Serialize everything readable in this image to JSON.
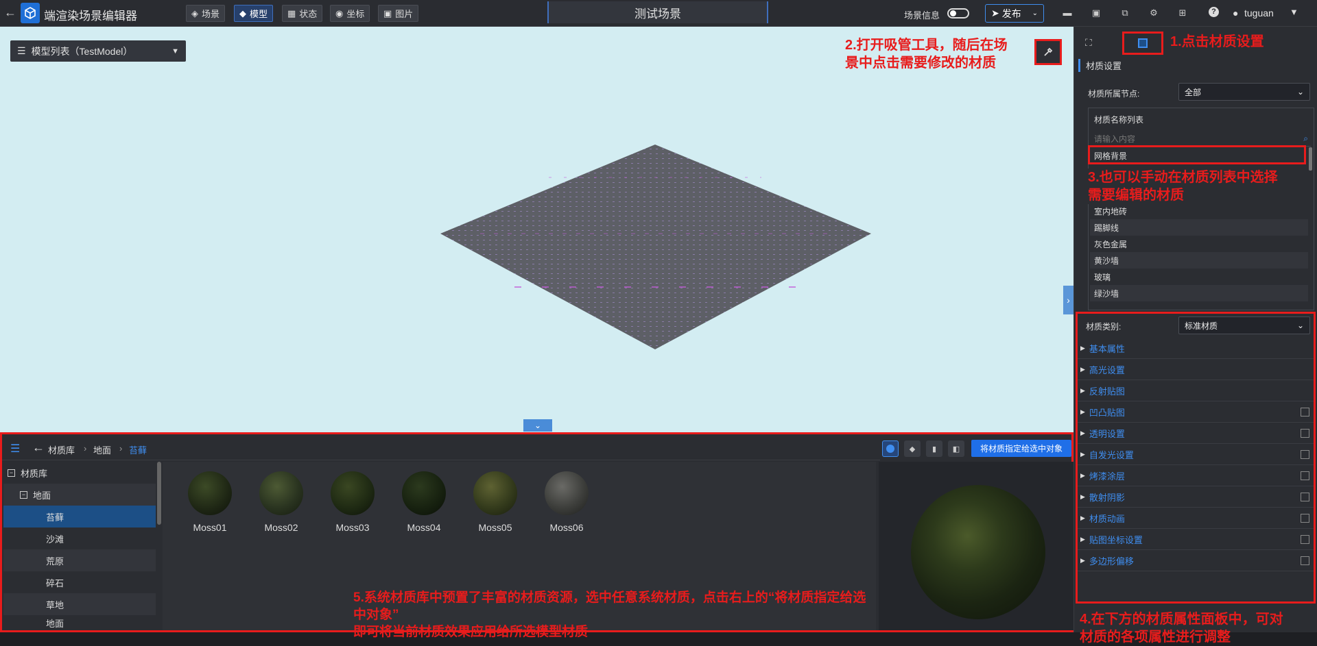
{
  "header": {
    "app_title": "端渲染场景编辑器",
    "nav": [
      {
        "label": "场景",
        "icon": "layers-icon"
      },
      {
        "label": "模型",
        "icon": "cube-icon"
      },
      {
        "label": "状态",
        "icon": "grid-icon"
      },
      {
        "label": "坐标",
        "icon": "pin-icon"
      },
      {
        "label": "图片",
        "icon": "image-icon"
      }
    ],
    "scene_title": "测试场景",
    "scene_info_label": "场景信息",
    "scene_info_on": false,
    "publish_label": "发布",
    "user": "tuguan"
  },
  "viewport": {
    "model_list_label": "模型列表（TestModel）",
    "annotation_2": [
      "2.打开吸管工具，随后在场",
      "景中点击需要修改的材质"
    ]
  },
  "right_panel": {
    "annotation_1": "1.点击材质设置",
    "section_title": "材质设置",
    "node_label": "材质所属节点:",
    "node_value": "全部",
    "list_title": "材质名称列表",
    "search_placeholder": "请输入内容",
    "materials": [
      "网格背景",
      "室内地砖",
      "踢脚线",
      "灰色金属",
      "黄沙墙",
      "玻璃",
      "绿沙墙"
    ],
    "annotation_3": [
      "3.也可以手动在材质列表中选择",
      "需要编辑的材质"
    ],
    "type_label": "材质类别:",
    "type_value": "标准材质",
    "properties": [
      {
        "name": "基本属性",
        "check": false
      },
      {
        "name": "高光设置",
        "check": false
      },
      {
        "name": "反射贴图",
        "check": false
      },
      {
        "name": "凹凸贴图",
        "check": true
      },
      {
        "name": "透明设置",
        "check": true
      },
      {
        "name": "自发光设置",
        "check": true
      },
      {
        "name": "烤漆涂层",
        "check": true
      },
      {
        "name": "散射阴影",
        "check": true
      },
      {
        "name": "材质动画",
        "check": true
      },
      {
        "name": "贴图坐标设置",
        "check": true
      },
      {
        "name": "多边形偏移",
        "check": true
      }
    ],
    "annotation_4": [
      "4.在下方的材质属性面板中，可对",
      "材质的各项属性进行调整"
    ]
  },
  "bottom_panel": {
    "breadcrumb": [
      "材质库",
      "地面",
      "苔藓"
    ],
    "tree": [
      {
        "label": "材质库",
        "level": 0,
        "expand": true
      },
      {
        "label": "地面",
        "level": 1,
        "expand": true
      },
      {
        "label": "苔藓",
        "level": 2,
        "selected": true
      },
      {
        "label": "沙滩",
        "level": 2
      },
      {
        "label": "荒原",
        "level": 2
      },
      {
        "label": "碎石",
        "level": 2
      },
      {
        "label": "草地",
        "level": 2
      },
      {
        "label": "地面",
        "level": 2
      }
    ],
    "swatches": [
      "Moss01",
      "Moss02",
      "Moss03",
      "Moss04",
      "Moss05",
      "Moss06"
    ],
    "assign_label": "将材质指定给选中对象",
    "annotation_5": [
      "5.系统材质库中预置了丰富的材质资源，选中任意系统材质，点击右上的“将材质指定给选中对象”",
      "即可将当前材质效果应用给所选模型材质"
    ]
  },
  "colors": {
    "accent": "#3f8ef0",
    "annotation": "#e81c1c"
  }
}
